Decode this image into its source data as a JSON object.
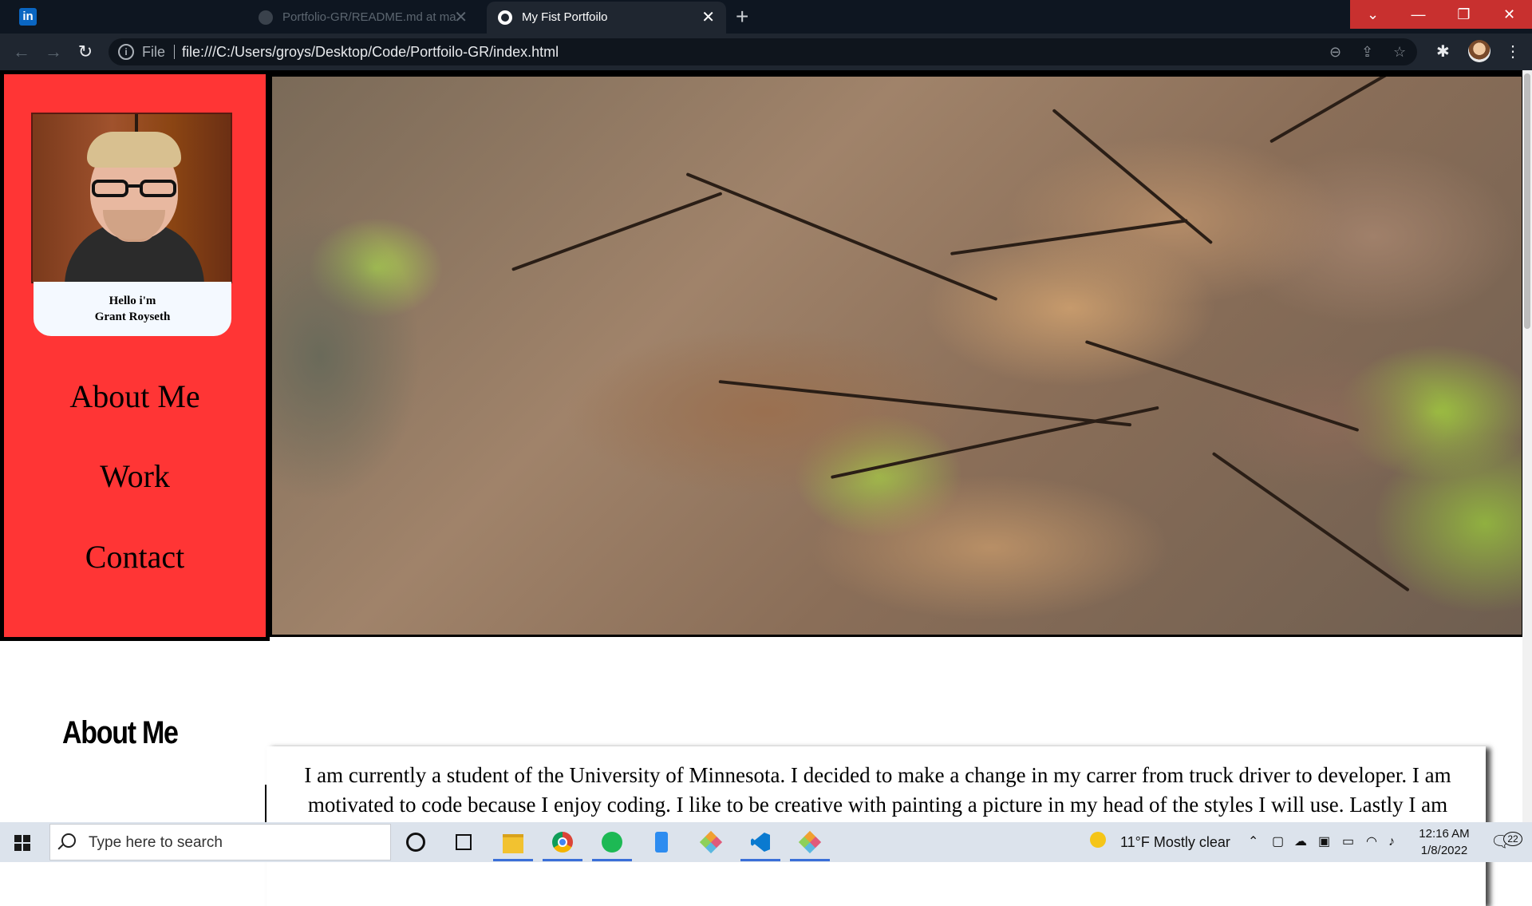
{
  "browser": {
    "tabs": [
      {
        "title": "Portfolio-GR/README.md at ma",
        "active": false
      },
      {
        "title": "My Fist Portfoilo",
        "active": true
      }
    ],
    "address": {
      "scheme": "File",
      "url": "file:///C:/Users/groys/Desktop/Code/Portfoilo-GR/index.html"
    }
  },
  "sidebar": {
    "greeting": "Hello i'm",
    "name": "Grant Royseth",
    "nav": [
      "About Me",
      "Work",
      "Contact"
    ]
  },
  "about": {
    "heading": "About Me",
    "text": "I am currently a student of the University of Minnesota. I decided to make a change in my carrer from truck driver to developer. I am motivated to code because I enjoy coding. I like to be creative with painting a picture in my head of the styles I will use. Lastly I am currently in the Minnesota National guard as an light infantry."
  },
  "taskbar": {
    "search_placeholder": "Type here to search",
    "weather": "11°F  Mostly clear",
    "time": "12:16 AM",
    "date": "1/8/2022",
    "notifications": "22"
  },
  "colors": {
    "sidebar": "#ff3535",
    "titlebar": "#0e1621",
    "window_controls": "#c8302f"
  }
}
